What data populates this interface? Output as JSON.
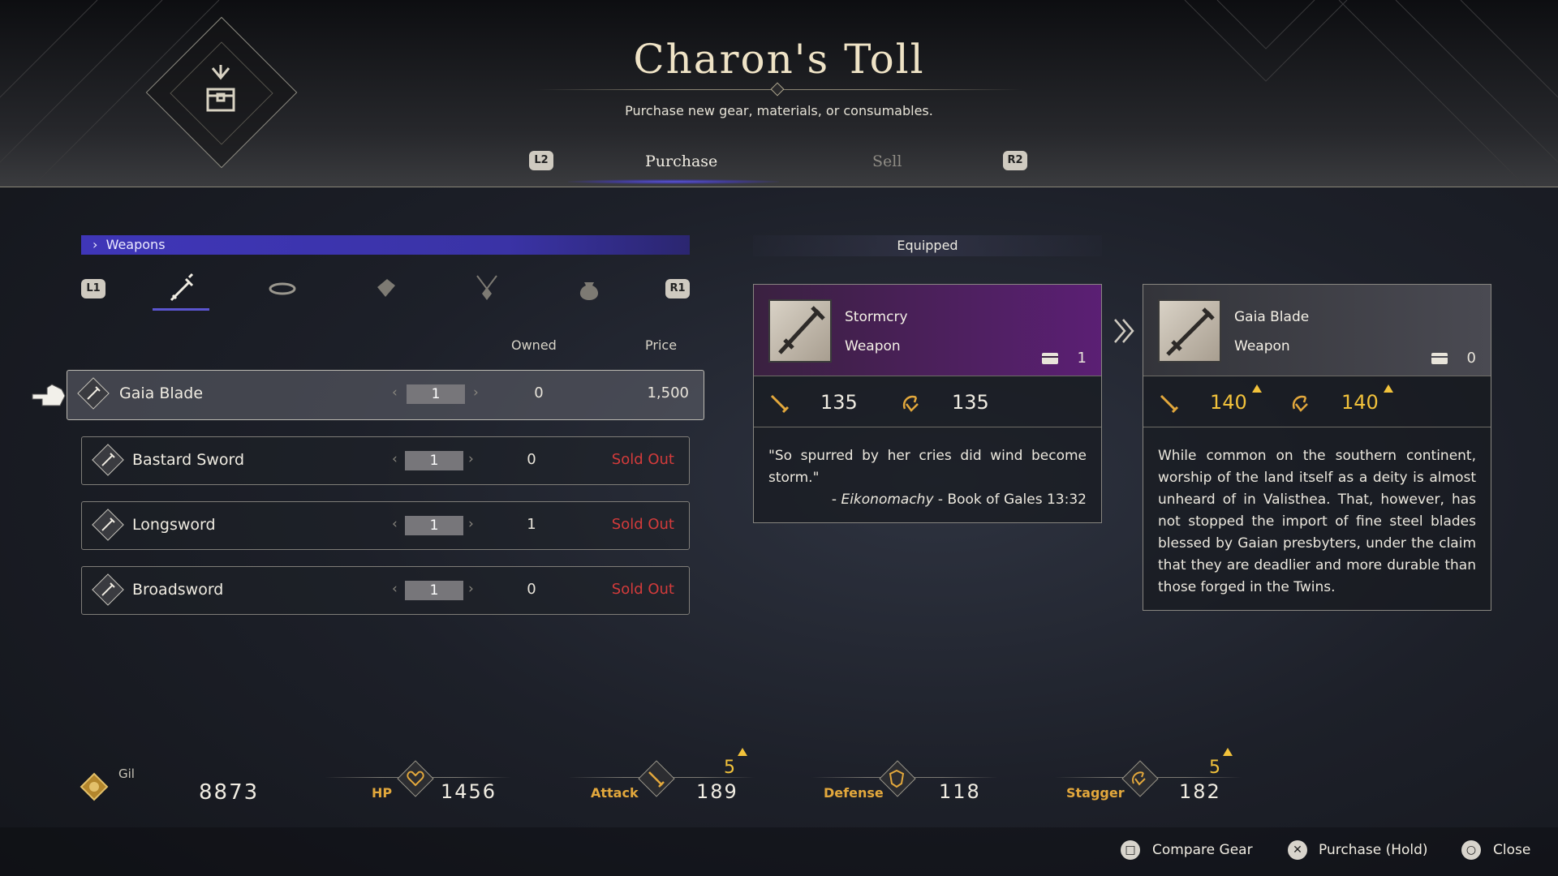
{
  "header": {
    "title": "Charon's Toll",
    "subtitle": "Purchase new gear, materials, or consumables.",
    "left_bumper": "L2",
    "right_bumper": "R2",
    "tabs": [
      {
        "label": "Purchase",
        "active": true
      },
      {
        "label": "Sell",
        "active": false
      }
    ]
  },
  "list": {
    "category": "Weapons",
    "left_bumper": "L1",
    "right_bumper": "R1",
    "category_icons": [
      "sword-icon",
      "belt-icon",
      "bracer-icon",
      "amulet-icon",
      "pouch-icon"
    ],
    "columns": {
      "owned": "Owned",
      "price": "Price"
    },
    "items": [
      {
        "name": "Gaia Blade",
        "qty": "1",
        "owned": "0",
        "price": "1,500",
        "sold_out": false,
        "selected": true
      },
      {
        "name": "Bastard Sword",
        "qty": "1",
        "owned": "0",
        "price": "Sold Out",
        "sold_out": true
      },
      {
        "name": "Longsword",
        "qty": "1",
        "owned": "1",
        "price": "Sold Out",
        "sold_out": true
      },
      {
        "name": "Broadsword",
        "qty": "1",
        "owned": "0",
        "price": "Sold Out",
        "sold_out": true
      }
    ]
  },
  "compare": {
    "equipped_label": "Equipped",
    "current": {
      "name": "Stormcry",
      "type": "Weapon",
      "owned": "1",
      "attack": "135",
      "stagger": "135",
      "quote": "\"So spurred by her cries did wind become storm.\"",
      "cite_prefix": "- ",
      "cite_title": "Eikonomachy",
      "cite_suffix": " - Book of Gales 13:32"
    },
    "candidate": {
      "name": "Gaia Blade",
      "type": "Weapon",
      "owned": "0",
      "attack": "140",
      "stagger": "140",
      "description": "While common on the southern continent, worship of the land itself as a deity is almost unheard of in Valisthea. That, however, has not stopped the import of fine steel blades blessed by Gaian presbyters, under the claim that they are deadlier and more durable than those forged in the Twins."
    }
  },
  "status": {
    "gil_label": "Gil",
    "gil": "8873",
    "hp_label": "HP",
    "hp": "1456",
    "attack_label": "Attack",
    "attack": "189",
    "attack_bonus": "5",
    "defense_label": "Defense",
    "defense": "118",
    "stagger_label": "Stagger",
    "stagger": "182",
    "stagger_bonus": "5"
  },
  "footer": {
    "compare": "Compare Gear",
    "purchase": "Purchase (Hold)",
    "close": "Close"
  },
  "colors": {
    "accent": "#3f36b8",
    "sold_out": "#d33b3b",
    "stat_up": "#f2c23b",
    "stat_label": "#e3a83c"
  }
}
